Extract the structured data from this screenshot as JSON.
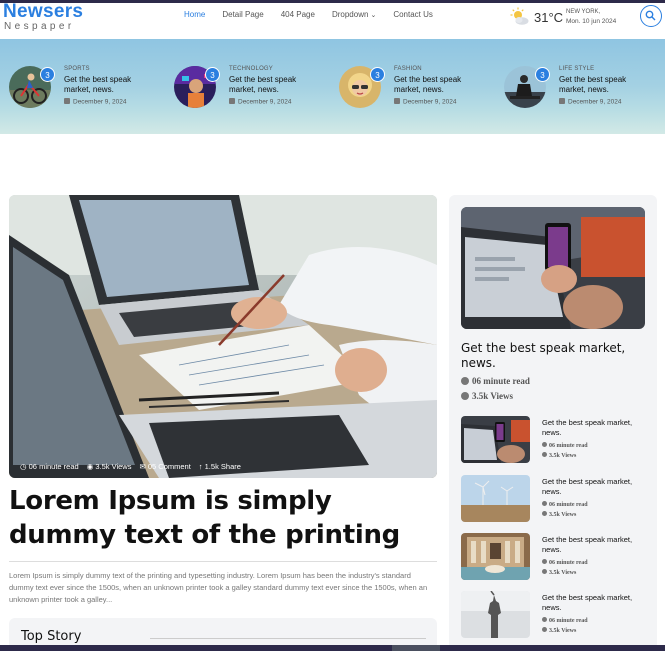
{
  "header": {
    "logo_main": "Newsers",
    "logo_sub": "Nespaper",
    "nav": [
      "Home",
      "Detail Page",
      "404 Page",
      "Dropdown",
      "Contact Us"
    ],
    "active_nav": "Home",
    "weather": {
      "temp": "31°C",
      "city": "NEW YORK,",
      "date": "Mon. 10 jun 2024",
      "icon": "sun-cloud-icon"
    },
    "search_icon": "search-icon"
  },
  "categories": [
    {
      "label": "SPORTS",
      "title": "Get the best speak market, news.",
      "date": "December 9, 2024",
      "badge": "3"
    },
    {
      "label": "TECHNOLOGY",
      "title": "Get the best speak market, news.",
      "date": "December 9, 2024",
      "badge": "3"
    },
    {
      "label": "FASHION",
      "title": "Get the best speak market, news.",
      "date": "December 9, 2024",
      "badge": "3"
    },
    {
      "label": "LIFE STYLE",
      "title": "Get the best speak market, news.",
      "date": "December 9, 2024",
      "badge": "3"
    }
  ],
  "main": {
    "meta": {
      "read": "06 minute read",
      "views": "3.5k Views",
      "comments": "05 Comment",
      "shares": "1.5k Share"
    },
    "headline": "Lorem Ipsum is simply dummy text of the printing",
    "summary": "Lorem Ipsum is simply dummy text of the printing and typesetting industry. Lorem Ipsum has been the industry's standard dummy text ever since the 1500s, when an unknown printer took a galley standard dummy text ever since the 1500s, when an unknown printer took a galley...",
    "top_story": "Top Story"
  },
  "sidebar": {
    "feature_title": "Get the best speak market, news.",
    "feature_read": "06 minute read",
    "feature_views": "3.5k Views",
    "items": [
      {
        "title": "Get the best speak market, news.",
        "read": "06 minute read",
        "views": "3.5k Views"
      },
      {
        "title": "Get the best speak market, news.",
        "read": "06 minute read",
        "views": "3.5k Views"
      },
      {
        "title": "Get the best speak market, news.",
        "read": "06 minute read",
        "views": "3.5k Views"
      },
      {
        "title": "Get the best speak market, news.",
        "read": "06 minute read",
        "views": "3.5k Views"
      }
    ]
  },
  "colors": {
    "accent": "#2b7fe0",
    "topbar": "#2d2a4a",
    "band_top": "#8fc5e2",
    "sidebar_bg": "#f3f4f6"
  }
}
